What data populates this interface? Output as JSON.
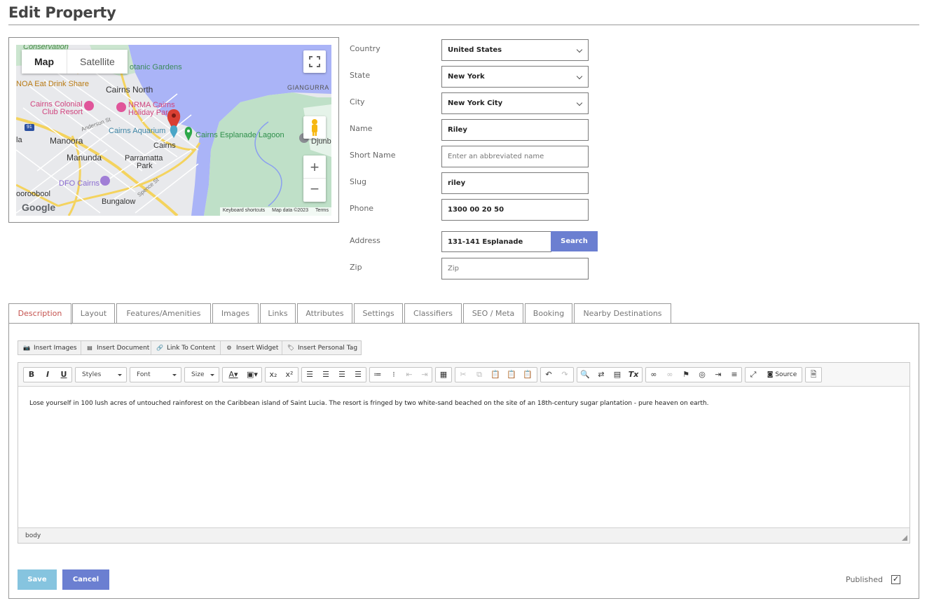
{
  "page": {
    "title": "Edit Property"
  },
  "map": {
    "type_map": "Map",
    "type_satellite": "Satellite",
    "labels": {
      "conservation": "Conservation",
      "botanic": "otanic Gardens",
      "noa": "NOA Eat Drink Share",
      "cairns_north": "Cairns North",
      "giangurra": "GIANGURRA",
      "colonial_1": "Cairns Colonial",
      "colonial_2": "Club Resort",
      "nrma_1": "NRMA Cairns",
      "nrma_2": "Holiday Par",
      "anderson": "Anderson St",
      "aquarium": "Cairns Aquarium",
      "lagoon": "Cairns Esplanade Lagoon",
      "djunb": "Djunb",
      "manoora": "Manoora",
      "cairns": "Cairns",
      "manunda": "Manunda",
      "parramatta_1": "Parramatta",
      "parramatta_2": "Park",
      "dfo": "DFO Cairns",
      "spence": "Spence St",
      "oooroobool": "ooroobool",
      "bungalow": "Bungalow",
      "la": "la",
      "route": "91"
    },
    "google_logo": "Google",
    "attribution": {
      "shortcuts": "Keyboard shortcuts",
      "data": "Map data ©2023",
      "terms": "Terms"
    },
    "icons": [
      "fullscreen-icon",
      "pegman-icon",
      "zoom-in-icon",
      "zoom-out-icon",
      "marker-icon"
    ]
  },
  "form": {
    "country": {
      "label": "Country",
      "value": "United States"
    },
    "state": {
      "label": "State",
      "value": "New York"
    },
    "city": {
      "label": "City",
      "value": "New York City"
    },
    "name": {
      "label": "Name",
      "value": "Riley"
    },
    "short_name": {
      "label": "Short Name",
      "placeholder": "Enter an abbreviated name"
    },
    "slug": {
      "label": "Slug",
      "value": "riley"
    },
    "phone": {
      "label": "Phone",
      "value": "1300 00 20 50"
    },
    "address": {
      "label": "Address",
      "value": "131-141 Esplanade",
      "search_label": "Search"
    },
    "zip": {
      "label": "Zip",
      "placeholder": "Zip"
    }
  },
  "tabs": [
    {
      "label": "Description",
      "active": true
    },
    {
      "label": "Layout"
    },
    {
      "label": "Features/Amenities"
    },
    {
      "label": "Images"
    },
    {
      "label": "Links"
    },
    {
      "label": "Attributes"
    },
    {
      "label": "Settings"
    },
    {
      "label": "Classifiers"
    },
    {
      "label": "SEO / Meta"
    },
    {
      "label": "Booking"
    },
    {
      "label": "Nearby Destinations"
    }
  ],
  "insert_toolbar": {
    "images": "Insert Images",
    "document": "Insert Document",
    "link": "Link To Content",
    "widget": "Insert Widget",
    "personal_tag": "Insert Personal Tag"
  },
  "editor": {
    "styles": "Styles",
    "font": "Font",
    "size": "Size",
    "source": "Source",
    "content": "Lose yourself in 100 lush acres of untouched rainforest on the Caribbean island of Saint Lucia. The resort is fringed by two white-sand beached on the site of an 18th-century sugar plantation - pure heaven on earth.",
    "status_path": "body"
  },
  "footer": {
    "save_label": "Save",
    "cancel_label": "Cancel",
    "published_label": "Published",
    "published_checked": true
  },
  "colors": {
    "primary_button": "#6b7fd1",
    "save_button": "#86c4df",
    "active_tab_text": "#c5534f",
    "water": "#aab4f7",
    "park": "#bfe0c8"
  }
}
